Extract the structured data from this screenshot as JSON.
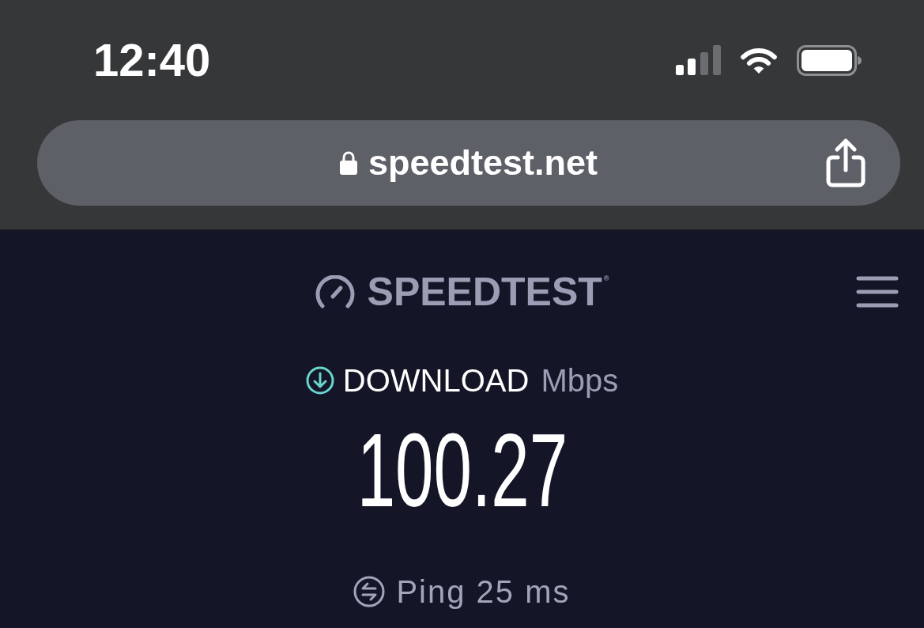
{
  "status_bar": {
    "time": "12:40"
  },
  "address_bar": {
    "url": "speedtest.net"
  },
  "header": {
    "logo": "SPEEDTEST$^{®}$"
  },
  "result": {
    "label": "DOWNLOAD",
    "unit": "Mbps",
    "value": "100.27"
  },
  "ping": {
    "text": "Ping 25 ms"
  }
}
